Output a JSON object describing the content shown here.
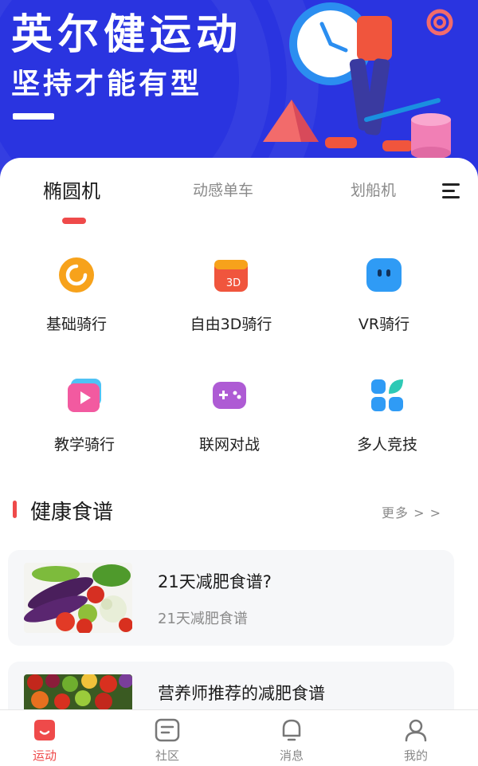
{
  "banner": {
    "title": "英尔健运动",
    "subtitle": "坚持才能有型"
  },
  "tabs": [
    {
      "label": "椭圆机",
      "active": true
    },
    {
      "label": "动感单车",
      "active": false
    },
    {
      "label": "划船机",
      "active": false
    }
  ],
  "modes": [
    {
      "label": "基础骑行",
      "icon": "ring-icon",
      "color": "#f7a21b"
    },
    {
      "label": "自由3D骑行",
      "icon": "3d-box-icon",
      "color": "#f0553d"
    },
    {
      "label": "VR骑行",
      "icon": "vr-face-icon",
      "color": "#2f9bf5"
    },
    {
      "label": "教学骑行",
      "icon": "video-play-icon",
      "color": "#f25aa0"
    },
    {
      "label": "联网对战",
      "icon": "gamepad-icon",
      "color": "#8a5cf0"
    },
    {
      "label": "多人竞技",
      "icon": "grid-leaf-icon",
      "color": "#2f9bf5"
    }
  ],
  "recipes_section": {
    "title": "健康食谱",
    "more": "更多 > >"
  },
  "recipes": [
    {
      "title": "21天减肥食谱?",
      "subtitle": "21天减肥食谱"
    },
    {
      "title": "营养师推荐的减肥食谱",
      "subtitle": ""
    }
  ],
  "bottom_nav": [
    {
      "label": "运动",
      "icon": "sport-icon",
      "active": true
    },
    {
      "label": "社区",
      "icon": "community-icon",
      "active": false
    },
    {
      "label": "消息",
      "icon": "bell-icon",
      "active": false
    },
    {
      "label": "我的",
      "icon": "profile-icon",
      "active": false
    }
  ],
  "colors": {
    "banner": "#2a34e0",
    "accent": "#ef4a4a"
  }
}
